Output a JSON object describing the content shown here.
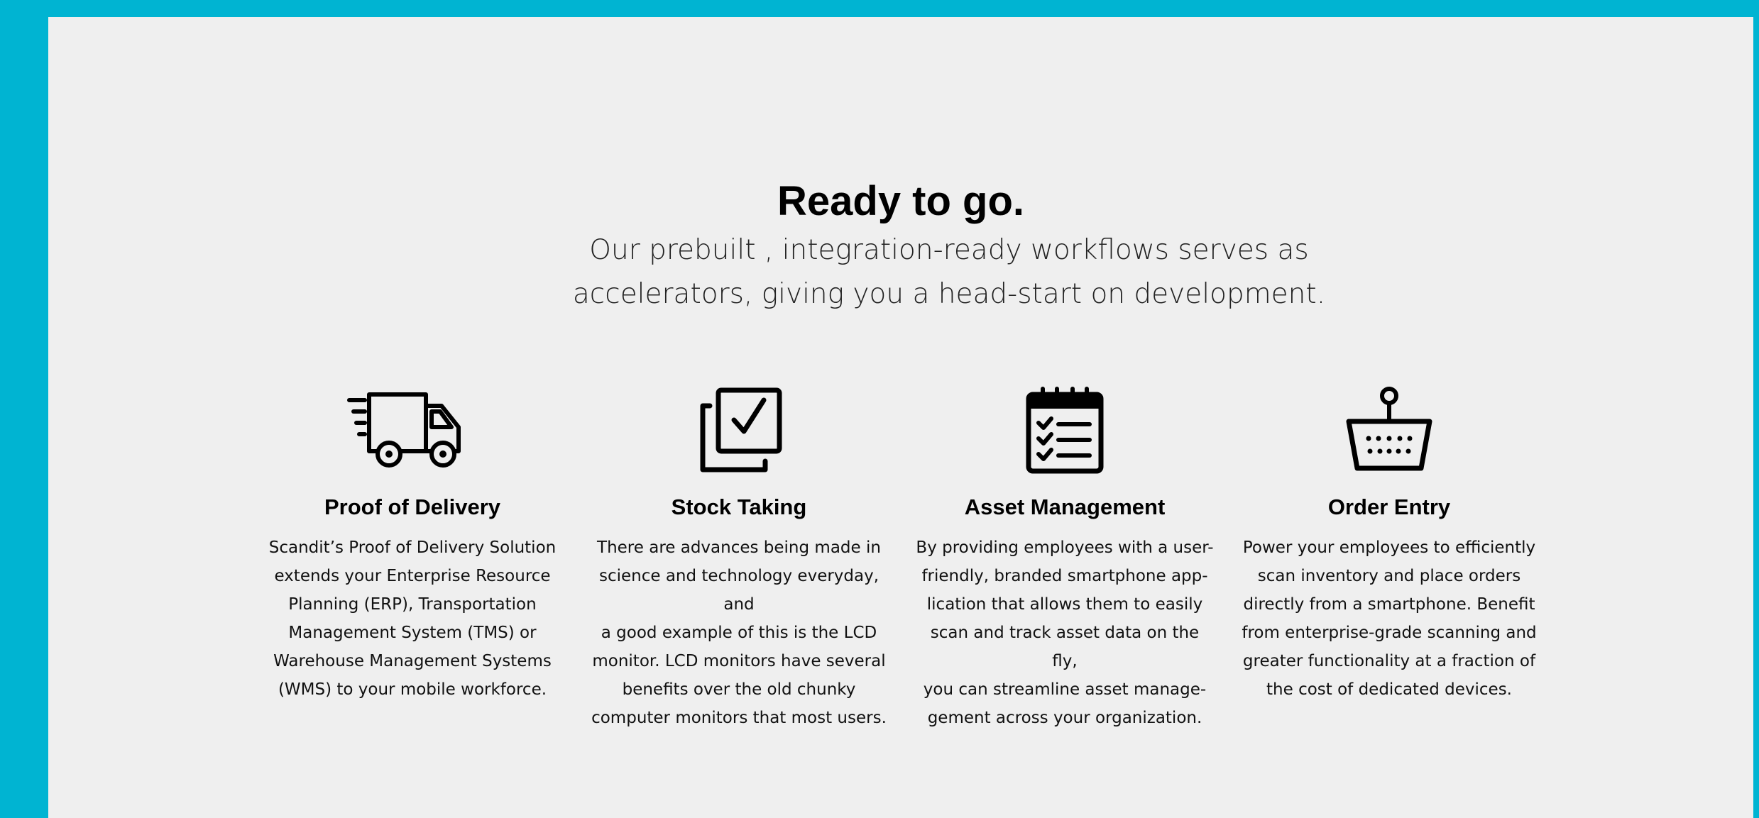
{
  "hero": {
    "title": "Ready to go.",
    "subtitle_line1": "Our prebuilt , integration-ready workflows serves as",
    "subtitle_line2": "accelerators, giving you a head-start on development."
  },
  "features": [
    {
      "icon": "delivery-truck-icon",
      "title": "Proof of Delivery",
      "lines": [
        "Scandit’s Proof of Delivery Solution",
        "extends your Enterprise Resource",
        "Planning (ERP), Transportation",
        "Management System (TMS) or",
        "Warehouse Management Systems",
        "(WMS) to your mobile workforce."
      ]
    },
    {
      "icon": "checklist-box-icon",
      "title": "Stock Taking",
      "lines": [
        "There are advances being made in",
        "science and technology everyday, and",
        "a good example of this is the LCD",
        "monitor. LCD monitors have several",
        "benefits over the old chunky",
        "computer monitors that most users."
      ]
    },
    {
      "icon": "clipboard-checklist-icon",
      "title": "Asset Management",
      "lines": [
        "By providing employees with a user-",
        "friendly, branded smartphone app-",
        "lication that allows them to easily",
        "scan and track asset data on the fly,",
        "you can streamline asset manage-",
        "gement across your organization."
      ]
    },
    {
      "icon": "shopping-basket-icon",
      "title": "Order Entry",
      "lines": [
        "Power your employees to efficiently",
        "scan inventory and place orders",
        "directly from a smartphone. Benefit",
        "from enterprise-grade scanning and",
        "greater functionality at a fraction of",
        "the cost of dedicated devices."
      ]
    }
  ],
  "colors": {
    "frame": "#00b4d2",
    "panel": "#efefef",
    "text": "#000000"
  }
}
